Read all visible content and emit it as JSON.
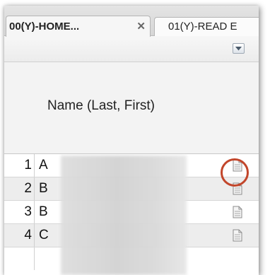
{
  "tabs": [
    {
      "label": "00(Y)-HOME...",
      "close_glyph": "✕",
      "active": true
    },
    {
      "label": "01(Y)-READ E",
      "active": false
    }
  ],
  "toolbar": {
    "dropdown_icon": "chevron-down-icon"
  },
  "grid": {
    "column_header": "Name (Last, First)",
    "rows": [
      {
        "num": "1",
        "name": "A",
        "icon": "document-icon"
      },
      {
        "num": "2",
        "name": "B",
        "icon": "document-icon"
      },
      {
        "num": "3",
        "name": "B",
        "icon": "document-icon"
      },
      {
        "num": "4",
        "name": "C",
        "icon": "document-icon"
      }
    ]
  },
  "colors": {
    "annotation_circle": "#c2462b",
    "alt_row": "#ededed"
  }
}
